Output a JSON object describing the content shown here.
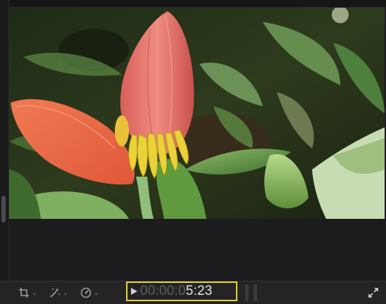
{
  "viewer": {
    "content": "banana flower video frame"
  },
  "toolbar": {
    "crop_icon": "crop-icon",
    "enhance_icon": "magic-wand-icon",
    "speed_icon": "speed-gauge-icon",
    "caret": "⌄",
    "timecode_dim": "00:00:0",
    "timecode_bright": "5:23",
    "highlight_color": "#e8d632",
    "fullscreen_icon": "fullscreen-icon"
  }
}
